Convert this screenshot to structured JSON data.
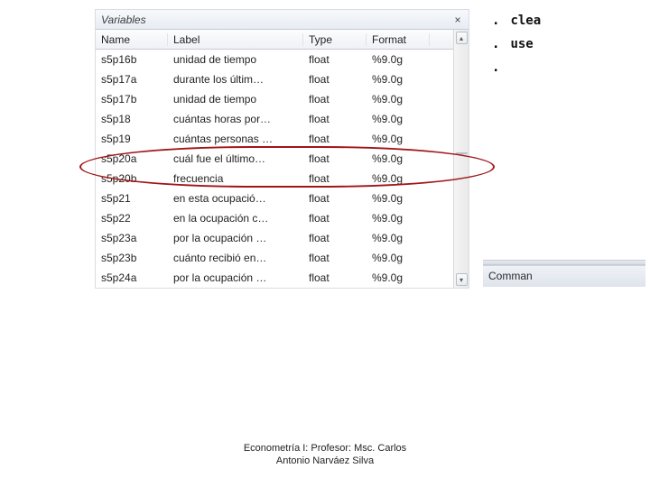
{
  "panel": {
    "title": "Variables",
    "close_glyph": "×",
    "columns": [
      "Name",
      "Label",
      "Type",
      "Format"
    ],
    "scroll_up": "▴",
    "scroll_down": "▾"
  },
  "rows": [
    {
      "name": "s5p16b",
      "label": "unidad de tiempo",
      "type": "float",
      "format": "%9.0g"
    },
    {
      "name": "s5p17a",
      "label": "durante los últim…",
      "type": "float",
      "format": "%9.0g"
    },
    {
      "name": "s5p17b",
      "label": "unidad de tiempo",
      "type": "float",
      "format": "%9.0g"
    },
    {
      "name": "s5p18",
      "label": "cuántas horas por…",
      "type": "float",
      "format": "%9.0g"
    },
    {
      "name": "s5p19",
      "label": "cuántas personas …",
      "type": "float",
      "format": "%9.0g"
    },
    {
      "name": "s5p20a",
      "label": "cuál fue el último…",
      "type": "float",
      "format": "%9.0g"
    },
    {
      "name": "s5p20b",
      "label": "frecuencia",
      "type": "float",
      "format": "%9.0g"
    },
    {
      "name": "s5p21",
      "label": "en esta ocupació…",
      "type": "float",
      "format": "%9.0g"
    },
    {
      "name": "s5p22",
      "label": "en la ocupación c…",
      "type": "float",
      "format": "%9.0g"
    },
    {
      "name": "s5p23a",
      "label": "por la ocupación …",
      "type": "float",
      "format": "%9.0g"
    },
    {
      "name": "s5p23b",
      "label": "cuánto recibió en…",
      "type": "float",
      "format": "%9.0g"
    },
    {
      "name": "s5p24a",
      "label": "por la ocupación …",
      "type": "float",
      "format": "%9.0g"
    }
  ],
  "history": {
    "items": [
      "clea",
      "use",
      ""
    ]
  },
  "command": {
    "label": "Comman"
  },
  "footer": {
    "line1": "Econometría I: Profesor: Msc. Carlos",
    "line2": "Antonio Narváez Silva"
  }
}
